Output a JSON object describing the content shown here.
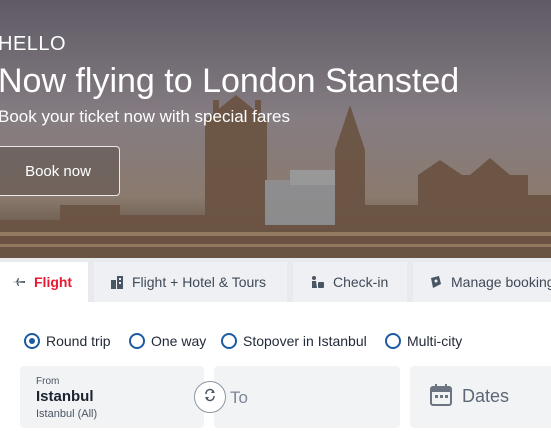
{
  "hero": {
    "greeting": "HELLO",
    "headline": "Now flying to London Stansted",
    "subline": "Book your ticket now with special fares",
    "cta_label": "Book now"
  },
  "tabs": [
    {
      "label": "Flight",
      "icon": "plane-icon",
      "active": true
    },
    {
      "label": "Flight + Hotel & Tours",
      "icon": "hotel-building-icon",
      "active": false
    },
    {
      "label": "Check-in",
      "icon": "check-in-icon",
      "active": false
    },
    {
      "label": "Manage booking",
      "icon": "ticket-icon",
      "active": false
    }
  ],
  "trip_types": [
    {
      "label": "Round trip",
      "selected": true
    },
    {
      "label": "One way",
      "selected": false
    },
    {
      "label": "Stopover in Istanbul",
      "selected": false
    },
    {
      "label": "Multi-city",
      "selected": false
    }
  ],
  "search": {
    "from_label": "From",
    "from_value": "Istanbul",
    "from_detail": "Istanbul (All)",
    "to_placeholder": "To",
    "dates_placeholder": "Dates"
  },
  "colors": {
    "accent_red": "#e81932",
    "radio_blue": "#1c5aa3"
  }
}
